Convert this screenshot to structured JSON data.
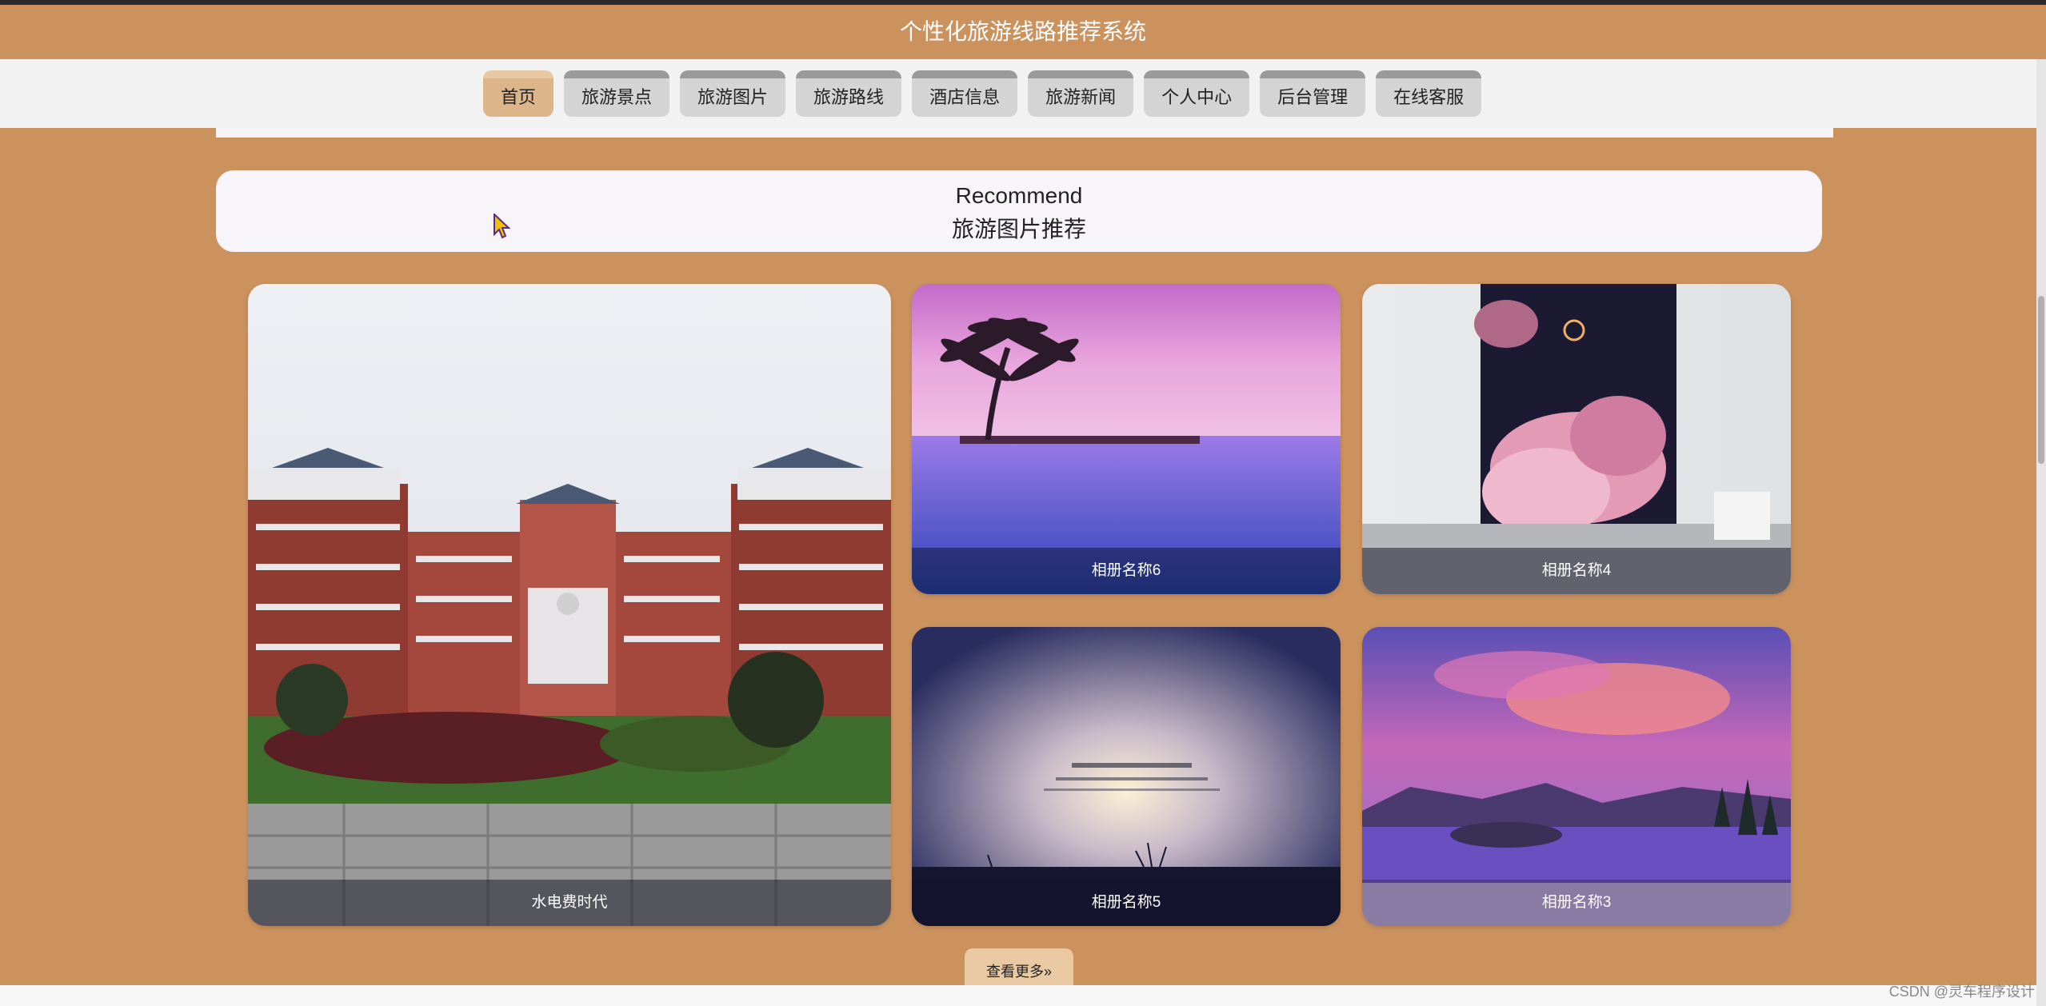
{
  "header": {
    "title": "个性化旅游线路推荐系统"
  },
  "nav": {
    "items": [
      {
        "label": "首页",
        "active": true
      },
      {
        "label": "旅游景点",
        "active": false
      },
      {
        "label": "旅游图片",
        "active": false
      },
      {
        "label": "旅游路线",
        "active": false
      },
      {
        "label": "酒店信息",
        "active": false
      },
      {
        "label": "旅游新闻",
        "active": false
      },
      {
        "label": "个人中心",
        "active": false
      },
      {
        "label": "后台管理",
        "active": false
      },
      {
        "label": "在线客服",
        "active": false
      }
    ]
  },
  "recommend": {
    "title_en": "Recommend",
    "title_cn": "旅游图片推荐"
  },
  "gallery": [
    {
      "caption": "水电费时代",
      "image": "campus-building-photo"
    },
    {
      "caption": "相册名称6",
      "image": "palm-tree-sunset-pool-photo"
    },
    {
      "caption": "相册名称4",
      "image": "pink-clouds-crescent-moon-poster-photo"
    },
    {
      "caption": "相册名称5",
      "image": "misty-sky-calligraphy-photo"
    },
    {
      "caption": "相册名称3",
      "image": "purple-sunset-lake-mountains-photo"
    }
  ],
  "more_button": {
    "label": "查看更多»"
  },
  "watermark": "CSDN @灵车程序设计",
  "colors": {
    "brand": "#cc925e",
    "nav_active": "#dcb58b",
    "nav_button": "#d4d4d4"
  }
}
